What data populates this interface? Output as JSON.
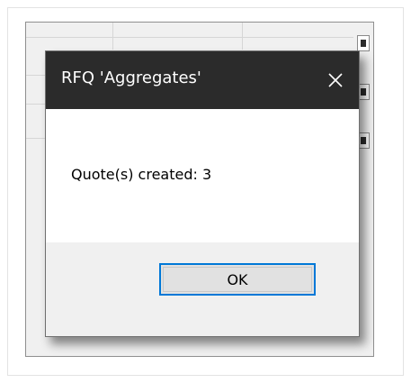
{
  "dialog": {
    "title": "RFQ 'Aggregates'",
    "message": "Quote(s) created: 3",
    "ok_label": "OK",
    "close_icon": "close-icon"
  },
  "colors": {
    "titlebar_bg": "#2b2b2b",
    "titlebar_text": "#ffffff",
    "footer_bg": "#f0f0f0",
    "button_bg": "#e1e1e1",
    "button_border_focus": "#0078d7"
  }
}
